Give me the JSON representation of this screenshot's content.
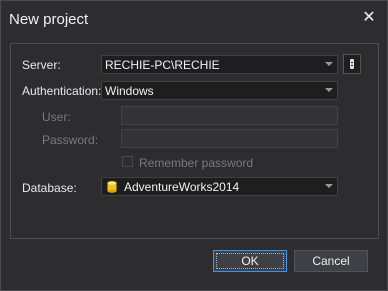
{
  "dialog": {
    "title": "New project",
    "close_glyph": "✕"
  },
  "form": {
    "server_label": "Server:",
    "server_value": "RECHIE-PC\\RECHIE",
    "auth_label": "Authentication:",
    "auth_value": "Windows",
    "user_label": "User:",
    "user_value": "",
    "password_label": "Password:",
    "password_value": "",
    "remember_label": "Remember password",
    "remember_checked": false,
    "database_label": "Database:",
    "database_value": "AdventureWorks2014"
  },
  "buttons": {
    "ok_label": "OK",
    "cancel_label": "Cancel"
  },
  "icons": {
    "close": "close-icon",
    "dropdown": "chevron-down-icon",
    "server_browse": "server-icon",
    "database": "database-icon"
  },
  "colors": {
    "background": "#2d2d30",
    "accent": "#3399ff",
    "database_icon": "#f0c419"
  }
}
